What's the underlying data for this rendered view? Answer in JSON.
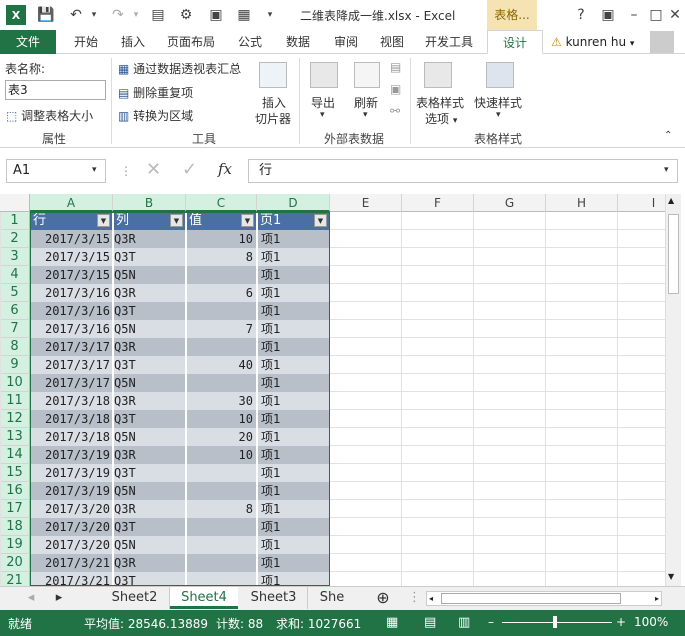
{
  "window": {
    "title": "二维表降成一维.xlsx - Excel",
    "context_tab": "表格..."
  },
  "tabs": [
    "文件",
    "开始",
    "插入",
    "页面布局",
    "公式",
    "数据",
    "审阅",
    "视图",
    "开发工具",
    "设计"
  ],
  "user": {
    "name": "kunren hu"
  },
  "ribbon": {
    "props": {
      "label": "表名称:",
      "value": "表3",
      "resize": "调整表格大小",
      "group": "属性"
    },
    "tools": {
      "pivot": "通过数据透视表汇总",
      "dedupe": "删除重复项",
      "convert": "转换为区域",
      "slicer1": "插入",
      "slicer2": "切片器",
      "group": "工具"
    },
    "external": {
      "export": "导出",
      "refresh": "刷新",
      "group": "外部表数据"
    },
    "styles": {
      "opt1": "表格样式",
      "opt2": "选项",
      "quick": "快速样式",
      "group": "表格样式"
    }
  },
  "formula_bar": {
    "cell": "A1",
    "content": "行",
    "fx": "fx"
  },
  "columns": [
    "A",
    "B",
    "C",
    "D",
    "E",
    "F",
    "G",
    "H",
    "I"
  ],
  "table": {
    "headers": [
      "行",
      "列",
      "值",
      "页1"
    ],
    "rows": [
      [
        "2017/3/15",
        "Q3R",
        "10",
        "项1"
      ],
      [
        "2017/3/15",
        "Q3T",
        "8",
        "项1"
      ],
      [
        "2017/3/15",
        "Q5N",
        "",
        "项1"
      ],
      [
        "2017/3/16",
        "Q3R",
        "6",
        "项1"
      ],
      [
        "2017/3/16",
        "Q3T",
        "",
        "项1"
      ],
      [
        "2017/3/16",
        "Q5N",
        "7",
        "项1"
      ],
      [
        "2017/3/17",
        "Q3R",
        "",
        "项1"
      ],
      [
        "2017/3/17",
        "Q3T",
        "40",
        "项1"
      ],
      [
        "2017/3/17",
        "Q5N",
        "",
        "项1"
      ],
      [
        "2017/3/18",
        "Q3R",
        "30",
        "项1"
      ],
      [
        "2017/3/18",
        "Q3T",
        "10",
        "项1"
      ],
      [
        "2017/3/18",
        "Q5N",
        "20",
        "项1"
      ],
      [
        "2017/3/19",
        "Q3R",
        "10",
        "项1"
      ],
      [
        "2017/3/19",
        "Q3T",
        "",
        "项1"
      ],
      [
        "2017/3/19",
        "Q5N",
        "",
        "项1"
      ],
      [
        "2017/3/20",
        "Q3R",
        "8",
        "项1"
      ],
      [
        "2017/3/20",
        "Q3T",
        "",
        "项1"
      ],
      [
        "2017/3/20",
        "Q5N",
        "",
        "项1"
      ],
      [
        "2017/3/21",
        "Q3R",
        "",
        "项1"
      ],
      [
        "2017/3/21",
        "Q3T",
        "",
        "项1"
      ]
    ]
  },
  "sheets": [
    "Sheet2",
    "Sheet4",
    "Sheet3",
    "She"
  ],
  "active_sheet": "Sheet4",
  "status": {
    "mode": "就绪",
    "avg": "平均值: 28546.13889",
    "count": "计数: 88",
    "sum": "求和: 1027661",
    "zoom": "100%"
  },
  "colors": {
    "excel_green": "#217346",
    "table_header": "#4a6fa5",
    "band_dark": "#b8bfc9",
    "band_light": "#d9dde4"
  }
}
